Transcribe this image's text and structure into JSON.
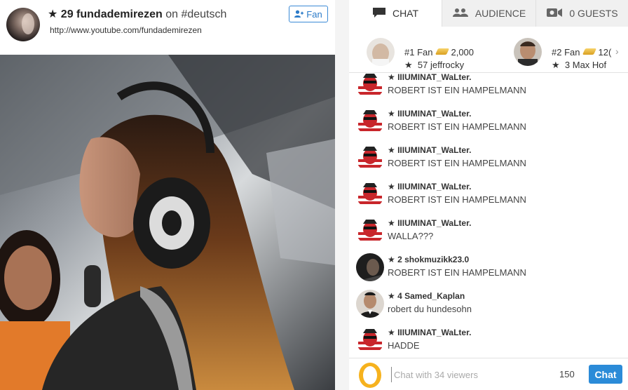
{
  "header": {
    "star": "★",
    "rank": "29",
    "username": "fundademirezen",
    "on_text": "on",
    "channel": "#deutsch",
    "url": "http://www.youtube.com/fundademirezen",
    "fan_button_label": "Fan"
  },
  "tabs": [
    {
      "label": "CHAT",
      "icon": "chat-bubble-icon",
      "active": true
    },
    {
      "label": "AUDIENCE",
      "icon": "people-icon",
      "active": false
    },
    {
      "label": "0 GUESTS",
      "icon": "video-camera-icon",
      "active": false
    }
  ],
  "top_fans": [
    {
      "rank_label": "#1 Fan",
      "coins": "2,000",
      "star": "★",
      "level": "57",
      "name": "jeffrocky"
    },
    {
      "rank_label": "#2 Fan",
      "coins": "12(",
      "star": "★",
      "level": "3",
      "name": "Max Hof"
    }
  ],
  "chat": {
    "messages": [
      {
        "star": "★",
        "level": "",
        "user": "IIIUMINAT_WaLter.",
        "text": "ROBERT IST EIN HAMPELMANN",
        "avatar": "mask-avatar"
      },
      {
        "star": "★",
        "level": "",
        "user": "IIIUMINAT_WaLter.",
        "text": "ROBERT IST EIN HAMPELMANN",
        "avatar": "mask-avatar"
      },
      {
        "star": "★",
        "level": "",
        "user": "IIIUMINAT_WaLter.",
        "text": "ROBERT IST EIN HAMPELMANN",
        "avatar": "mask-avatar"
      },
      {
        "star": "★",
        "level": "",
        "user": "IIIUMINAT_WaLter.",
        "text": "ROBERT IST EIN HAMPELMANN",
        "avatar": "mask-avatar"
      },
      {
        "star": "★",
        "level": "",
        "user": "IIIUMINAT_WaLter.",
        "text": "WALLA???",
        "avatar": "mask-avatar"
      },
      {
        "star": "★",
        "level": "2",
        "user": "shokmuzikk23.0",
        "text": "ROBERT IST EIN HAMPELMANN",
        "avatar": "dark-avatar"
      },
      {
        "star": "★",
        "level": "4",
        "user": "Samed_Kaplan",
        "text": "robert du hundesohn",
        "avatar": "suit-avatar"
      },
      {
        "star": "★",
        "level": "",
        "user": "IIIUMINAT_WaLter.",
        "text": "HADDE",
        "avatar": "mask-avatar"
      }
    ],
    "placeholder": "Chat with 34 viewers",
    "char_count": "150",
    "send_label": "Chat"
  },
  "colors": {
    "accent": "#2b8bd8",
    "gold": "#e8b640"
  }
}
